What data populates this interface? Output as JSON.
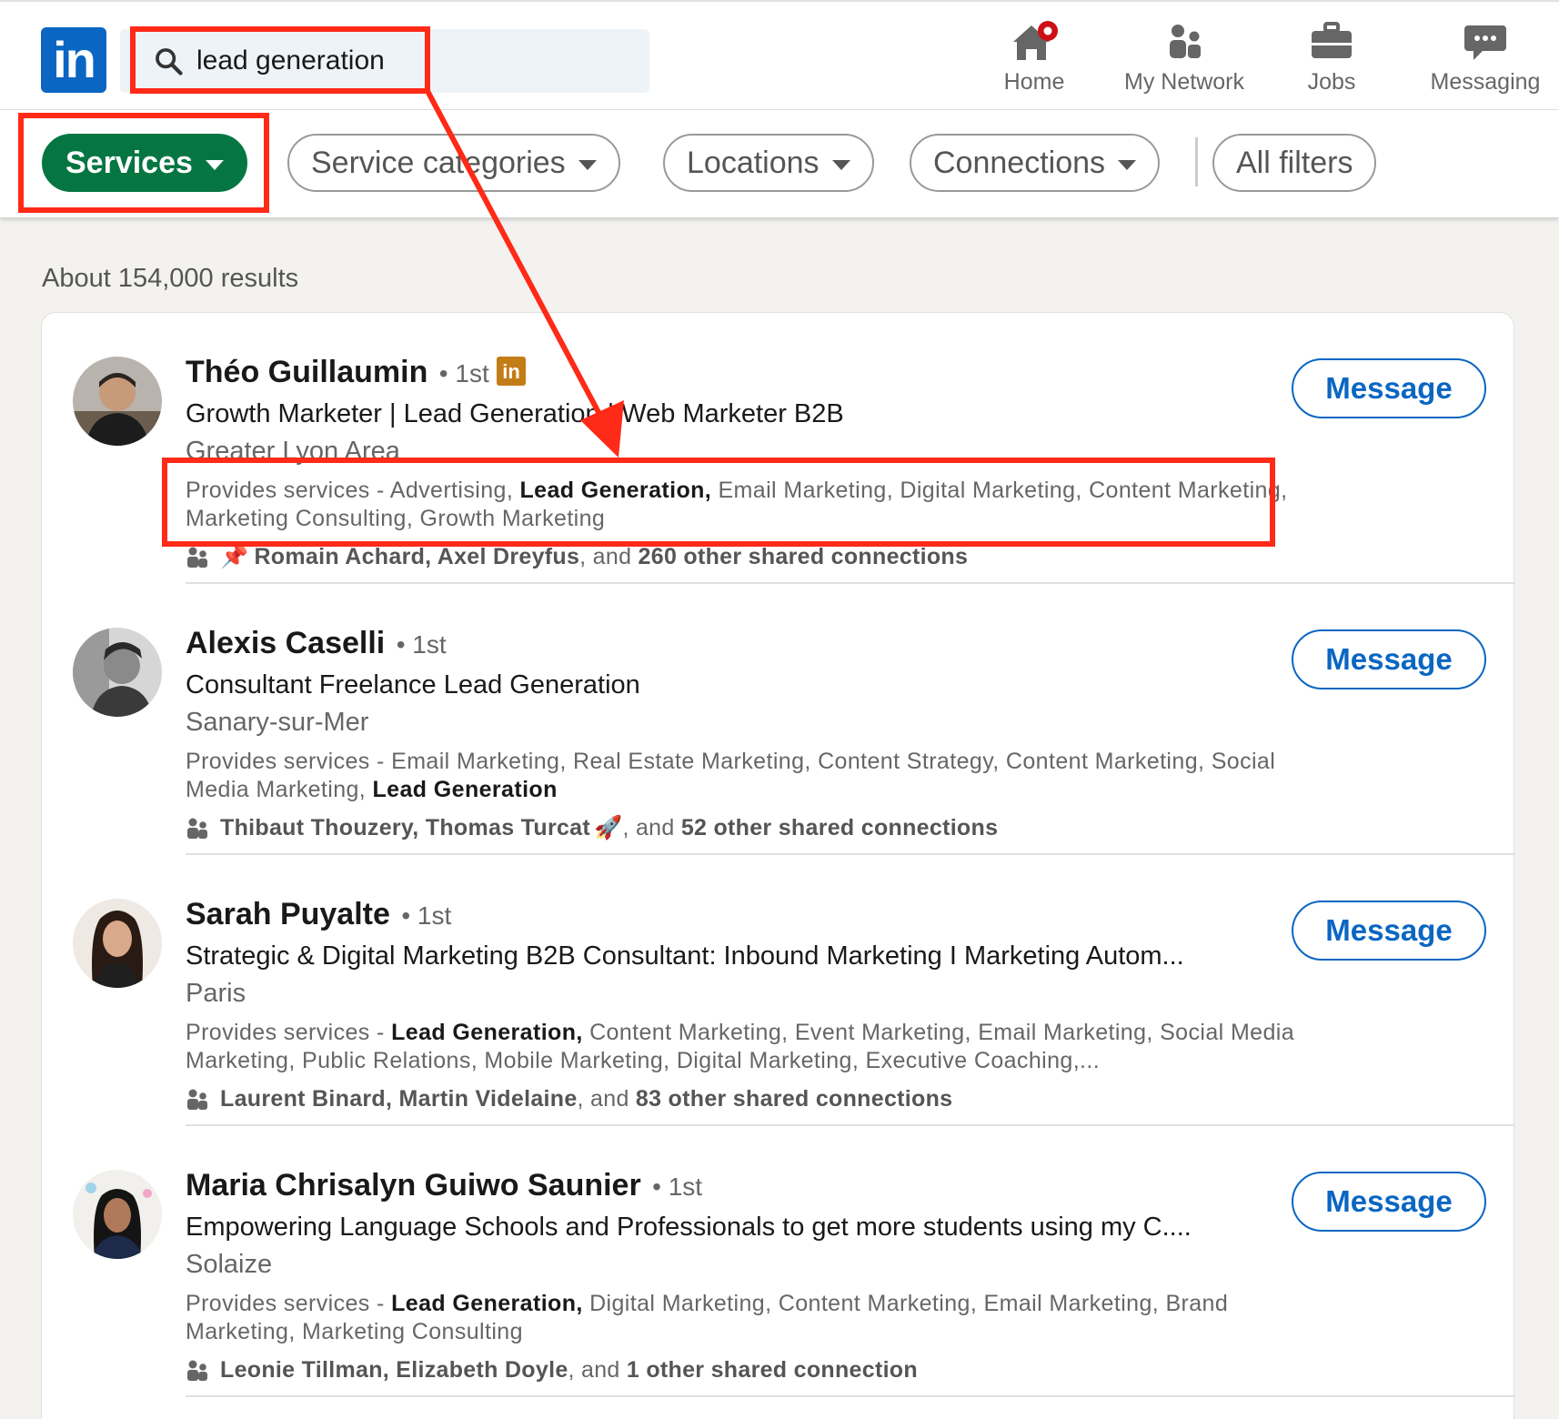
{
  "nav": {
    "search_value": "lead generation",
    "items": [
      {
        "label": "Home"
      },
      {
        "label": "My Network"
      },
      {
        "label": "Jobs"
      },
      {
        "label": "Messaging"
      }
    ]
  },
  "filters": {
    "services": "Services",
    "service_categories": "Service categories",
    "locations": "Locations",
    "connections": "Connections",
    "all_filters": "All filters"
  },
  "results": {
    "count_text": "About 154,000 results",
    "provides_prefix": "Provides services - ",
    "message_label": "Message",
    "people": [
      {
        "name": "Théo Guillaumin",
        "degree": "• 1st",
        "headline": "Growth Marketer | Lead Generation | Web Marketer B2B",
        "location": "Greater Lyon Area",
        "services_bold": "Lead Generation,",
        "services_before": "Advertising, ",
        "services_after": " Email Marketing, Digital Marketing, Content Marketing, Marketing Consulting, Growth Marketing",
        "shared_names": "Romain Achard, Axel Dreyfus",
        "shared_mid": ", and ",
        "shared_count": "260 other shared connections"
      },
      {
        "name": "Alexis Caselli",
        "degree": "• 1st",
        "headline": "Consultant Freelance Lead Generation",
        "location": "Sanary-sur-Mer",
        "services_before": "Email Marketing, Real Estate Marketing, Content Strategy, Content Marketing, Social Media Marketing, ",
        "services_bold": "Lead Generation",
        "services_after": "",
        "shared_names": "Thibaut Thouzery, Thomas Turcat",
        "shared_mid": ", and ",
        "shared_count": "52 other shared connections"
      },
      {
        "name": "Sarah Puyalte",
        "degree": "• 1st",
        "headline": "Strategic & Digital Marketing B2B Consultant: Inbound Marketing I Marketing Autom...",
        "location": "Paris",
        "services_before": "",
        "services_bold": "Lead Generation,",
        "services_after": " Content Marketing, Event Marketing, Email Marketing, Social Media Marketing, Public Relations, Mobile Marketing, Digital Marketing, Executive Coaching,...",
        "shared_names": "Laurent Binard, Martin Videlaine",
        "shared_mid": ", and ",
        "shared_count": "83 other shared connections"
      },
      {
        "name": "Maria Chrisalyn Guiwo Saunier",
        "degree": "• 1st",
        "headline": "Empowering Language Schools and Professionals to get more students using my C....",
        "location": "Solaize",
        "services_before": "",
        "services_bold": "Lead Generation,",
        "services_after": " Digital Marketing, Content Marketing, Email Marketing, Brand Marketing, Marketing Consulting",
        "shared_names": "Leonie Tillman, Elizabeth Doyle",
        "shared_mid": ", and ",
        "shared_count": "1 other shared connection"
      }
    ]
  },
  "colors": {
    "brand": "#0a66c2",
    "services_active": "#057642",
    "annotation": "#ff2a17"
  }
}
